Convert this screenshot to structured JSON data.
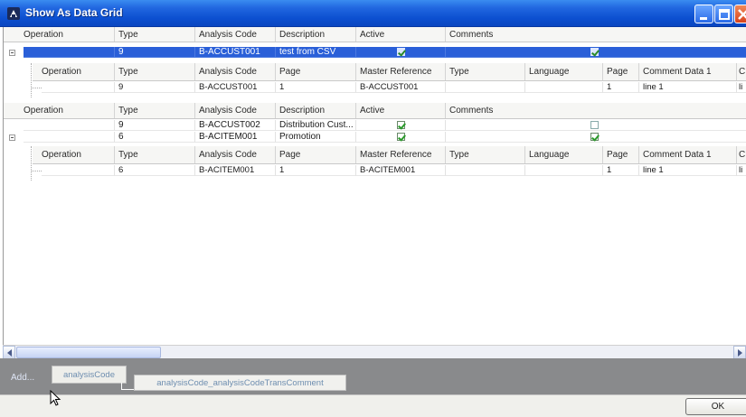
{
  "window": {
    "title": "Show As Data Grid"
  },
  "grid": {
    "level1_header": [
      "Operation",
      "Type",
      "Analysis Code",
      "Description",
      "Active",
      "Comments"
    ],
    "level2_header": [
      "Operation",
      "Type",
      "Analysis Code",
      "Page",
      "Master Reference",
      "Type",
      "Language",
      "Page",
      "Comment Data 1",
      "C"
    ],
    "row1": {
      "type": "9",
      "code": "B-ACCUST001",
      "description": "test from CSV",
      "active": true,
      "comments_checked": true
    },
    "row1_sub": {
      "type": "9",
      "code": "B-ACCUST001",
      "page": "1",
      "master_ref": "B-ACCUST001",
      "page2": "1",
      "comment_data": "line 1",
      "c": "li"
    },
    "row2": {
      "type": "9",
      "code": "B-ACCUST002",
      "description": "Distribution Cust...",
      "active": true,
      "comments_checked": false
    },
    "row3": {
      "type": "6",
      "code": "B-ACITEM001",
      "description": "Promotion",
      "active": true,
      "comments_checked": true
    },
    "row3_sub": {
      "type": "6",
      "code": "B-ACITEM001",
      "page": "1",
      "master_ref": "B-ACITEM001",
      "page2": "1",
      "comment_data": "line 1",
      "c": "li"
    }
  },
  "tabs": {
    "add_label": "Add...",
    "tab1": "analysisCode",
    "tab2": "analysisCode_analysisCodeTransComment"
  },
  "footer": {
    "ok_label": "OK"
  }
}
